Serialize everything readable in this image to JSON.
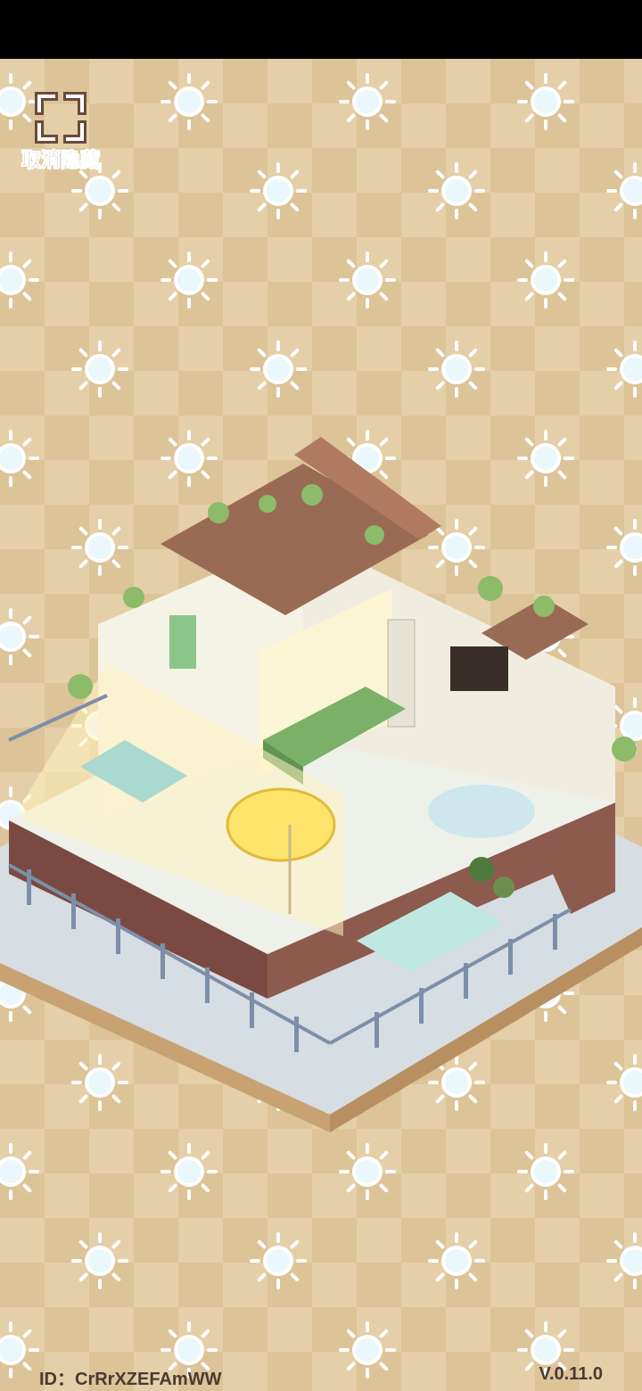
{
  "top_button": {
    "label": "取消隐藏",
    "icon": "expand-frame-icon"
  },
  "footer": {
    "id_label": "ID：",
    "id_value": "CrRrXZEFAmWW",
    "version": "V.0.11.0"
  },
  "colors": {
    "background": "#e5cfa8",
    "checker": "#dcc398",
    "sun_fill": "#eaf7fb",
    "roof": "#9a6b54",
    "wall": "#f4f0e4",
    "floor_tile": "#dfe8ee",
    "fence": "#7d8fa8",
    "leaf": "#8cbb6a"
  }
}
